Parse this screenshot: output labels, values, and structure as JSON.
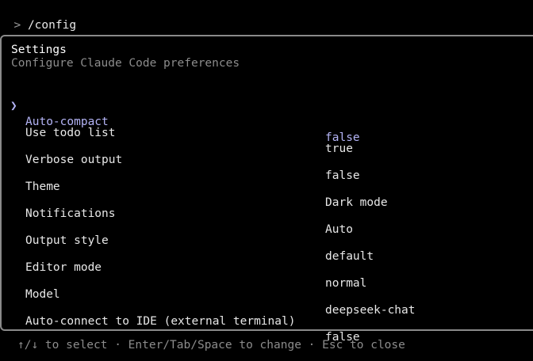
{
  "prompt": {
    "marker": ">",
    "command": "/config"
  },
  "panel": {
    "title": "Settings",
    "subtitle": "Configure Claude Code preferences"
  },
  "settings": {
    "pointer": "❯",
    "selected_index": 0,
    "items": [
      {
        "label": "Auto-compact",
        "value": "false"
      },
      {
        "label": "Use todo list",
        "value": "true"
      },
      {
        "label": "Verbose output",
        "value": "false"
      },
      {
        "label": "Theme",
        "value": "Dark mode"
      },
      {
        "label": "Notifications",
        "value": "Auto"
      },
      {
        "label": "Output style",
        "value": "default"
      },
      {
        "label": "Editor mode",
        "value": "normal"
      },
      {
        "label": "Model",
        "value": "deepseek-chat"
      },
      {
        "label": "Auto-connect to IDE (external terminal)",
        "value": "false"
      }
    ]
  },
  "footer": {
    "hint": "↑/↓ to select · Enter/Tab/Space to change · Esc to close"
  },
  "colors": {
    "background": "#000000",
    "selected": "#b4b4f6",
    "muted": "#8c8c8c",
    "border": "#8a8a8a"
  }
}
